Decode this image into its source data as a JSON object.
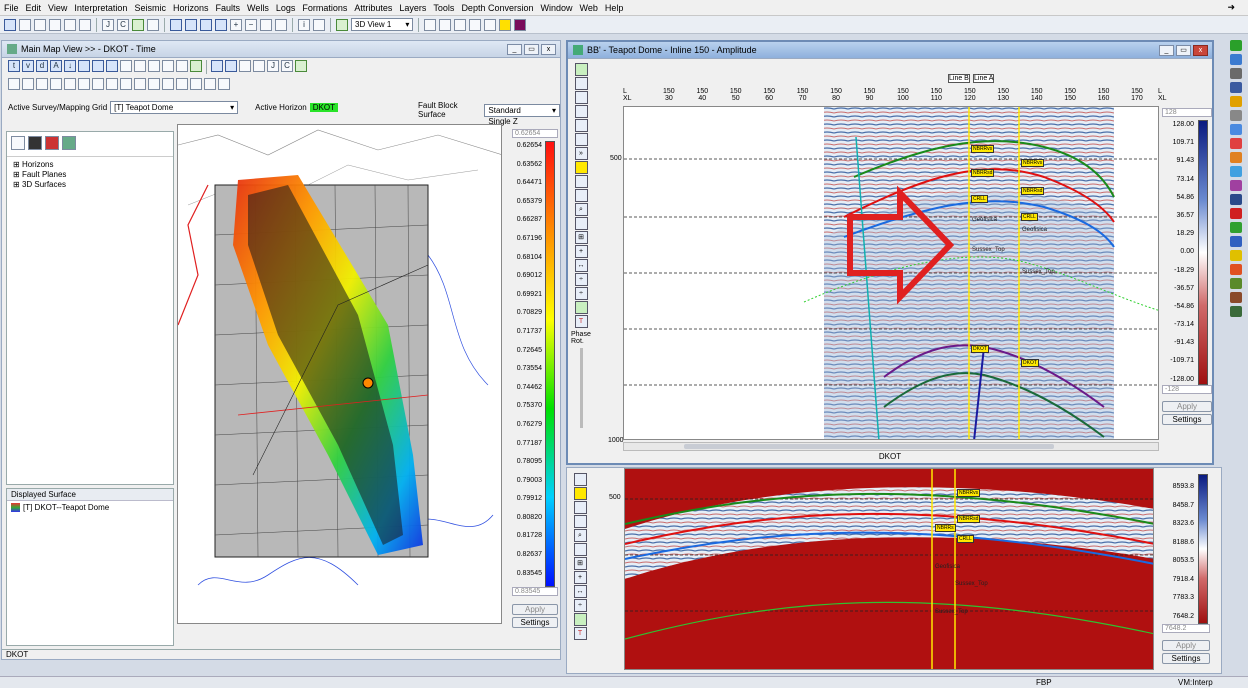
{
  "menu": [
    "File",
    "Edit",
    "View",
    "Interpretation",
    "Seismic",
    "Horizons",
    "Faults",
    "Wells",
    "Logs",
    "Formations",
    "Attributes",
    "Layers",
    "Tools",
    "Depth Conversion",
    "Window",
    "Web",
    "Help"
  ],
  "toolbar": {
    "view_combo": "3D View 1"
  },
  "map_window": {
    "title": "Main Map View >> - DKOT - Time",
    "survey_label": "Active Survey/Mapping Grid",
    "survey_value": "[T] Teapot Dome",
    "horizon_label": "Active Horizon",
    "horizon_value": "DKOT",
    "fault_label": "Fault Block Surface",
    "fault_value": "Standard Single Z",
    "tree": [
      "Horizons",
      "Fault Planes",
      "3D Surfaces"
    ],
    "displayed_surface_label": "Displayed Surface",
    "displayed_surface_item": "[T] DKOT--Teapot Dome",
    "status_text": "DKOT",
    "colorbar_top_box": "0.62654",
    "colorbar_bottom_box": "0.83545",
    "colorbar_values": [
      "0.62654",
      "0.63562",
      "0.64471",
      "0.65379",
      "0.66287",
      "0.67196",
      "0.68104",
      "0.69012",
      "0.69921",
      "0.70829",
      "0.71737",
      "0.72645",
      "0.73554",
      "0.74462",
      "0.75370",
      "0.76279",
      "0.77187",
      "0.78095",
      "0.79003",
      "0.79912",
      "0.80820",
      "0.81728",
      "0.82637",
      "0.83545"
    ],
    "apply_label": "Apply",
    "settings_label": "Settings"
  },
  "seismic_window": {
    "title": "BB' - Teapot Dome - Inline 150 - Amplitude",
    "axis_left_top": "L",
    "axis_left_bottom": "XL",
    "axis_il_labels": [
      "150",
      "150",
      "150",
      "150",
      "150",
      "150",
      "150",
      "150",
      "150",
      "150",
      "150",
      "150",
      "150",
      "150",
      "150"
    ],
    "axis_xl_labels": [
      "30",
      "40",
      "50",
      "60",
      "70",
      "80",
      "90",
      "100",
      "110",
      "120",
      "130",
      "140",
      "150",
      "160",
      "170"
    ],
    "axis_right_top": "L",
    "axis_right_bottom": "XL",
    "time_labels": [
      "500",
      "1000"
    ],
    "line_labels": [
      "Line A",
      "Line B"
    ],
    "phase_label": "Phase Rot.",
    "colorbar_top_box": "128",
    "colorbar_bottom_box": "-128",
    "colorbar_values": [
      "128.00",
      "109.71",
      "91.43",
      "73.14",
      "54.86",
      "36.57",
      "18.29",
      "0.00",
      "-18.29",
      "-36.57",
      "-54.86",
      "-73.14",
      "-91.43",
      "-109.71",
      "-128.00"
    ],
    "apply_label": "Apply",
    "settings_label": "Settings",
    "bottom_label": "DKOT",
    "markers": [
      "NBRRvs",
      "NBRRvs",
      "NBRRsd",
      "NBRRsd",
      "CRLL",
      "CRLL",
      "DKOT",
      "DKOT"
    ],
    "horizon_labels": [
      "Geofisica",
      "Geofisica",
      "Sussex_Top",
      "Sussex_Top"
    ]
  },
  "lower_window": {
    "time_label": "500",
    "colorbar_values": [
      "8593.8",
      "8458.7",
      "8323.6",
      "8188.6",
      "8053.5",
      "7918.4",
      "7783.3",
      "7648.2"
    ],
    "colorbar_bottom_box": "7648.2",
    "apply_label": "Apply",
    "settings_label": "Settings",
    "markers": [
      "NBRRvs",
      "NBRRsd",
      "NBRRs",
      "CRLL"
    ],
    "horizon_labels": [
      "Geofisica",
      "Sussex_Top",
      "Sussex_Top"
    ]
  },
  "statusbar": {
    "fbp": "FBP",
    "vm": "VM:Interp"
  },
  "colors": {
    "accent_green": "#29e329",
    "arrow_red": "#e02020",
    "horizon_red": "#c01818",
    "highlight_yellow": "#ffe800"
  }
}
